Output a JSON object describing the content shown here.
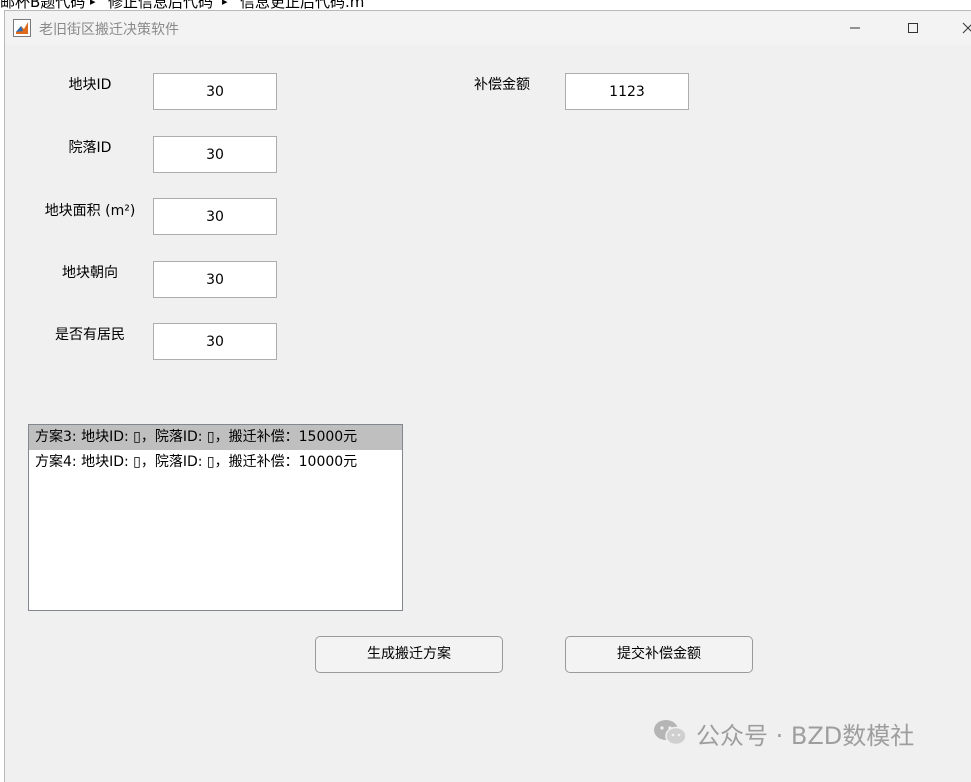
{
  "background": {
    "breadcrumbs": [
      "邮杯B题代码",
      "修正信息后代码",
      "信息更正后代码.m"
    ]
  },
  "window": {
    "title": "老旧街区搬迁决策软件",
    "controls": {
      "minimize": "—",
      "maximize": "☐",
      "close": "✕"
    }
  },
  "form": {
    "fields": [
      {
        "label": "地块ID",
        "value": "30"
      },
      {
        "label": "院落ID",
        "value": "30"
      },
      {
        "label": "地块面积 (m²)",
        "value": "30"
      },
      {
        "label": "地块朝向",
        "value": "30"
      },
      {
        "label": "是否有居民",
        "value": "30"
      }
    ],
    "compensation": {
      "label": "补偿金额",
      "value": "1123"
    }
  },
  "plans": {
    "items": [
      "方案3: 地块ID: ▯，院落ID: ▯，搬迁补偿：15000元",
      "方案4: 地块ID: ▯，院落ID: ▯，搬迁补偿：10000元"
    ],
    "selected_index": 0
  },
  "buttons": {
    "generate": "生成搬迁方案",
    "submit": "提交补偿金额"
  },
  "watermark": {
    "text": "公众号 · BZD数模社",
    "icon": "wechat-icon"
  },
  "colors": {
    "window_bg": "#f0f0f0",
    "selected_row": "#bfbfbf",
    "title_text": "#8a8a8a"
  }
}
